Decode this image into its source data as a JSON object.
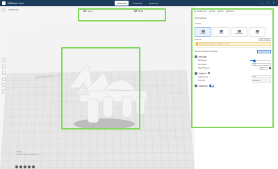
{
  "window": {
    "app_name": "UltiMaker Cura",
    "tabs": [
      "PREPARE",
      "PREVIEW",
      "MONITOR"
    ],
    "active_tab": 0
  },
  "viewport": {
    "file_name": "UMS5_Wo...",
    "printer_1": {
      "name": "UltiMaker S5 Pro...",
      "detail": "AA 0.4"
    },
    "printer_2": {
      "name": "UltiMaker S5 Pro...",
      "detail": "BB 0.4"
    },
    "plate_label": "UltiMaker S5",
    "object_info": {
      "name": "Tiling",
      "dims": "199.0 x 126.2 x 100.0 mm"
    },
    "highlight_color": "#7ed957"
  },
  "panel": {
    "header": {
      "items": [
        "Generic PLA",
        "PLA",
        "PLA",
        "Normal"
      ],
      "close_icon": "close-icon"
    },
    "title": "Print settings",
    "profiles_title": "Profiles",
    "profiles": [
      {
        "label": "Default",
        "active": true
      },
      {
        "label": "Visual",
        "active": false
      },
      {
        "label": "Engineering",
        "active": false
      },
      {
        "label": "Draft",
        "active": false
      }
    ],
    "profile_row": {
      "label": "Extrusion",
      "value": "Fast - 0.2mm"
    },
    "notice": "Recommended settings for UltiMaker printers",
    "custom": {
      "label": "Recommended print settings",
      "button": "Show Custom"
    },
    "strength": {
      "title": "Strength",
      "infill_label": "Infill density",
      "infill_value": 20,
      "infill_pattern_label": "Infill Pattern",
      "infill_pattern_value": "Grid",
      "shell_label": "Shell Thickness",
      "shell_value": "0.8"
    },
    "support": {
      "title": "Support",
      "type_label": "Support Type",
      "type_value": "Tree",
      "print_with_label": "Print with",
      "print_with_value": "Extruder 1"
    },
    "adhesion": {
      "title": "Adhesion",
      "enabled": true
    }
  }
}
